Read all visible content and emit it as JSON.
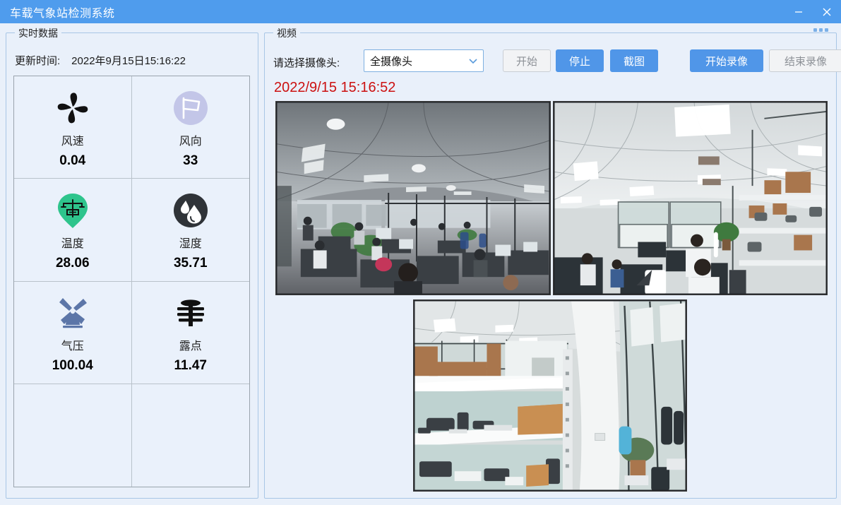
{
  "window": {
    "title": "车载气象站检测系统",
    "minimize_icon": "minimize-icon",
    "close_icon": "close-icon",
    "titlebar_color": "#4f9ced",
    "background_color": "#e9f0fa"
  },
  "realtime": {
    "legend": "实时数据",
    "update_label": "更新时间:",
    "update_time": "2022年9月15日15:16:22",
    "metrics": [
      {
        "icon": "fan-icon",
        "name": "风速",
        "value": "0.04",
        "icon_color": "#111111"
      },
      {
        "icon": "flag-circle-icon",
        "name": "风向",
        "value": "33",
        "icon_color": "#c3c6e8"
      },
      {
        "icon": "map-pin-weather-icon",
        "name": "温度",
        "value": "28.06",
        "icon_color": "#2ec48c"
      },
      {
        "icon": "water-drops-icon",
        "name": "湿度",
        "value": "35.71",
        "icon_color": "#2f3338"
      },
      {
        "icon": "windmill-icon",
        "name": "气压",
        "value": "100.04",
        "icon_color": "#5c76a8"
      },
      {
        "icon": "pagoda-icon",
        "name": "露点",
        "value": "11.47",
        "icon_color": "#111111"
      },
      {
        "icon": "",
        "name": "",
        "value": "",
        "icon_color": ""
      },
      {
        "icon": "",
        "name": "",
        "value": "",
        "icon_color": ""
      }
    ]
  },
  "video": {
    "legend": "视频",
    "camera_label": "请选择摄像头:",
    "camera_selected": "全摄像头",
    "camera_chevron_icon": "chevron-down-icon",
    "buttons": {
      "start": "开始",
      "stop": "停止",
      "snapshot": "截图",
      "record_start": "开始录像",
      "record_stop": "结束录像"
    },
    "timestamp": "2022/9/15 15:16:52",
    "timestamp_color": "#cc1111",
    "accent_color": "#5096e8",
    "feeds": [
      {
        "name": "camera-feed-1",
        "scene": "office-open-plan"
      },
      {
        "name": "camera-feed-2",
        "scene": "office-shelving-right"
      },
      {
        "name": "camera-feed-3",
        "scene": "storage-shelves"
      }
    ]
  }
}
